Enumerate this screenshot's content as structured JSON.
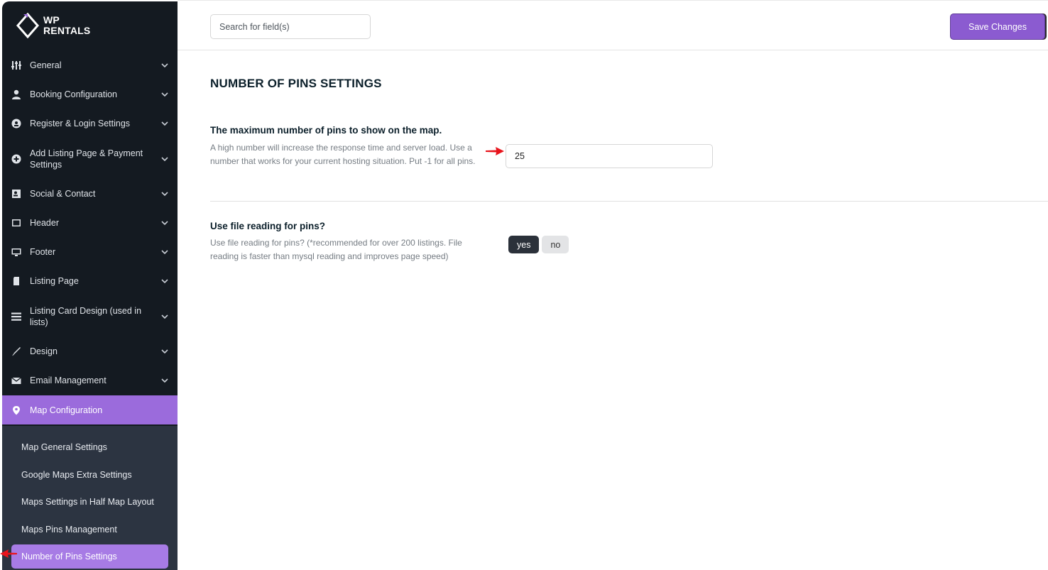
{
  "brand": {
    "line1": "WP",
    "line2": "RENTALS"
  },
  "sidebar": {
    "items": [
      {
        "label": "General",
        "icon": "sliders-icon"
      },
      {
        "label": "Booking Configuration",
        "icon": "user-icon"
      },
      {
        "label": "Register & Login Settings",
        "icon": "login-icon"
      },
      {
        "label": "Add Listing Page & Payment Settings",
        "icon": "plus-circle-icon"
      },
      {
        "label": "Social & Contact",
        "icon": "contact-card-icon"
      },
      {
        "label": "Header",
        "icon": "header-icon"
      },
      {
        "label": "Footer",
        "icon": "monitor-icon"
      },
      {
        "label": "Listing Page",
        "icon": "document-icon"
      },
      {
        "label": "Listing Card Design (used in lists)",
        "icon": "list-icon"
      },
      {
        "label": "Design",
        "icon": "brush-icon"
      },
      {
        "label": "Email Management",
        "icon": "envelope-icon"
      },
      {
        "label": "Map Configuration",
        "icon": "map-pin-icon",
        "active": true
      }
    ],
    "submenu": [
      {
        "label": "Map General Settings"
      },
      {
        "label": "Google Maps Extra Settings"
      },
      {
        "label": "Maps Settings in Half Map Layout"
      },
      {
        "label": "Maps Pins Management"
      },
      {
        "label": "Number of Pins Settings",
        "active": true
      }
    ]
  },
  "topbar": {
    "search_placeholder": "Search for field(s)",
    "save_label": "Save Changes"
  },
  "main": {
    "title": "NUMBER OF PINS SETTINGS",
    "fields": [
      {
        "title": "The maximum number of pins to show on the map.",
        "description": "A high number will increase the response time and server load. Use a number that works for your current hosting situation. Put -1 for all pins.",
        "value": "25"
      },
      {
        "title": "Use file reading for pins?",
        "description": "Use file reading for pins? (*recommended for over 200 listings. File reading is faster than mysql reading and improves page speed)",
        "options": [
          "yes",
          "no"
        ],
        "selected": "yes"
      }
    ]
  },
  "colors": {
    "sidebar_bg": "#141a21",
    "submenu_bg": "#2c3441",
    "accent": "#9b6bdc",
    "arrow": "#e8141c"
  }
}
